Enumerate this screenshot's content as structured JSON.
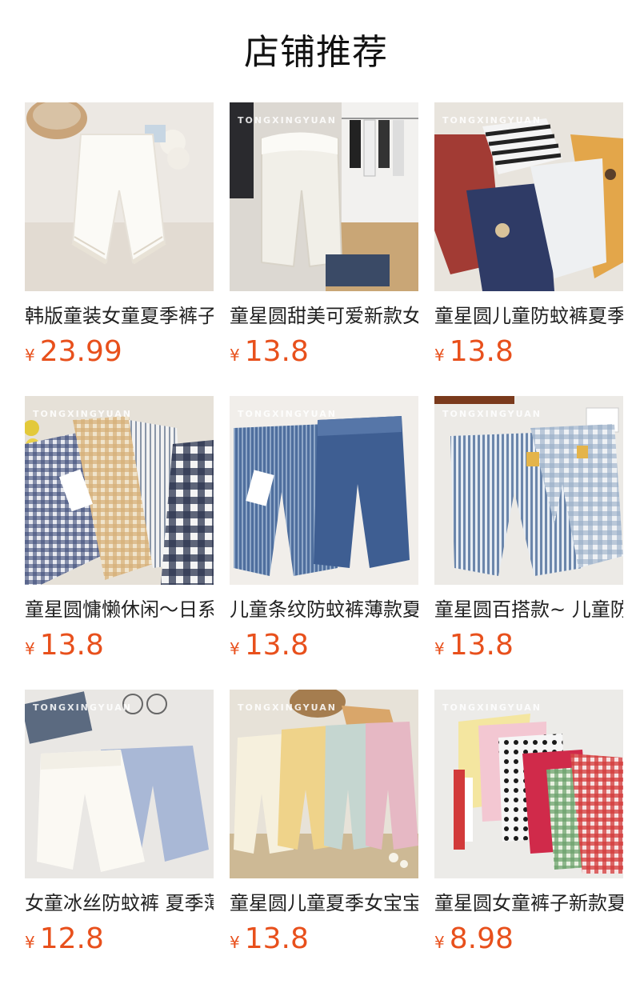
{
  "header": {
    "title": "店铺推荐"
  },
  "colors": {
    "price": "#e8501c",
    "title": "#111111"
  },
  "products": [
    {
      "name": "韩版童装女童夏季裤子",
      "currency": "¥",
      "price": "23.99",
      "watermark": "",
      "image": "white-lace-pants"
    },
    {
      "name": "童星圆甜美可爱新款女",
      "currency": "¥",
      "price": "13.8",
      "watermark": "TONGXINGYUAN",
      "image": "cream-bloomers-hanger"
    },
    {
      "name": "童星圆儿童防蚊裤夏季",
      "currency": "¥",
      "price": "13.8",
      "watermark": "TONGXINGYUAN",
      "image": "assorted-pants-pile"
    },
    {
      "name": "童星圆慵懒休闲～日系",
      "currency": "¥",
      "price": "13.8",
      "watermark": "TONGXINGYUAN",
      "image": "plaid-pants-row"
    },
    {
      "name": "儿童条纹防蚊裤薄款夏",
      "currency": "¥",
      "price": "13.8",
      "watermark": "TONGXINGYUAN",
      "image": "blue-denim-pants"
    },
    {
      "name": "童星圆百搭款~ 儿童防",
      "currency": "¥",
      "price": "13.8",
      "watermark": "TONGXINGYUAN",
      "image": "striped-check-pants"
    },
    {
      "name": "女童冰丝防蚊裤 夏季薄",
      "currency": "¥",
      "price": "12.8",
      "watermark": "TONGXINGYUAN",
      "image": "white-blue-pants"
    },
    {
      "name": "童星圆儿童夏季女宝宝",
      "currency": "¥",
      "price": "13.8",
      "watermark": "TONGXINGYUAN",
      "image": "pastel-pants-row"
    },
    {
      "name": "童星圆女童裤子新款夏",
      "currency": "¥",
      "price": "8.98",
      "watermark": "TONGXINGYUAN",
      "image": "colorful-bloomers-stack"
    }
  ]
}
